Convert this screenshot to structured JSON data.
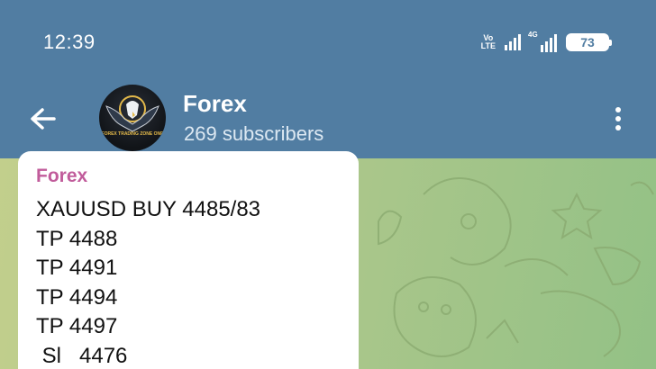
{
  "status_bar": {
    "time": "12:39",
    "volte_top": "Vo",
    "volte_bottom": "LTE",
    "network_label": "4G",
    "battery": "73"
  },
  "header": {
    "title": "Forex",
    "subtitle": "269 subscribers",
    "avatar_text": "FOREX TRADING ZONE ONE"
  },
  "message": {
    "author": "Forex",
    "lines": [
      "XAUUSD BUY 4485/83",
      "TP 4488",
      "TP 4491",
      "TP 4494",
      "TP 4497",
      " Sl   4476"
    ]
  },
  "colors": {
    "header_bg": "#517da2",
    "author": "#c15c9b",
    "bubble": "#ffffff"
  },
  "icons": [
    "back-arrow-icon",
    "more-vertical-icon",
    "signal-icon",
    "battery-icon"
  ]
}
